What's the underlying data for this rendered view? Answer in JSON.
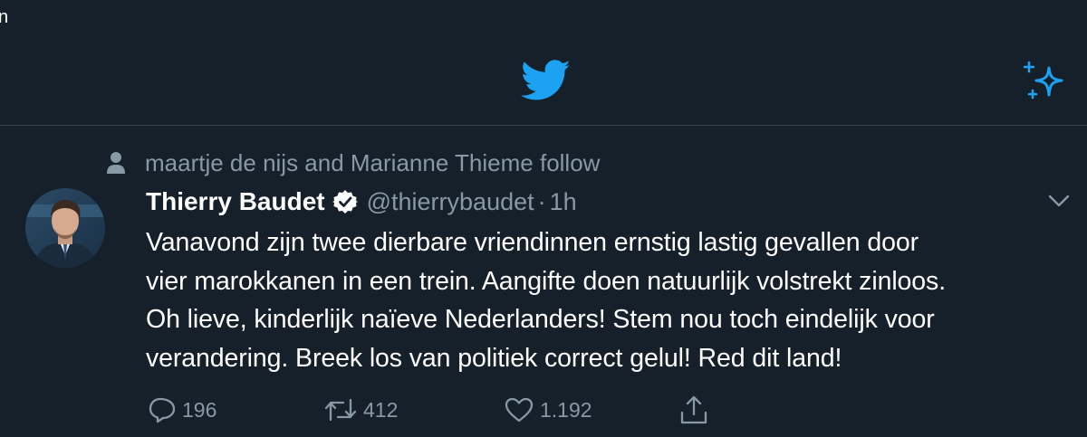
{
  "status_bar": {
    "fragment": "n"
  },
  "header": {
    "logo_icon": "twitter-bird-icon",
    "action_icon": "sparkle-icon"
  },
  "colors": {
    "background": "#15202b",
    "accent": "#1da1f2",
    "secondary_text": "#8899a6",
    "divider": "#38444d"
  },
  "tweet": {
    "social_context": "maartje de nijs and Marianne Thieme follow",
    "author": {
      "display_name": "Thierry Baudet",
      "handle": "@thierrybaudet",
      "verified": true
    },
    "separator": "·",
    "timestamp": "1h",
    "text_lines": [
      "Vanavond zijn twee dierbare vriendinnen ernstig lastig gevallen door",
      "vier marokkanen in een trein. Aangifte doen natuurlijk volstrekt zinloos.",
      "Oh lieve, kinderlijk naïeve Nederlanders! Stem nou toch eindelijk voor",
      "verandering. Breek los van politiek correct gelul! Red dit land!"
    ],
    "stats": {
      "replies": "196",
      "retweets": "412",
      "likes": "1.192"
    }
  }
}
